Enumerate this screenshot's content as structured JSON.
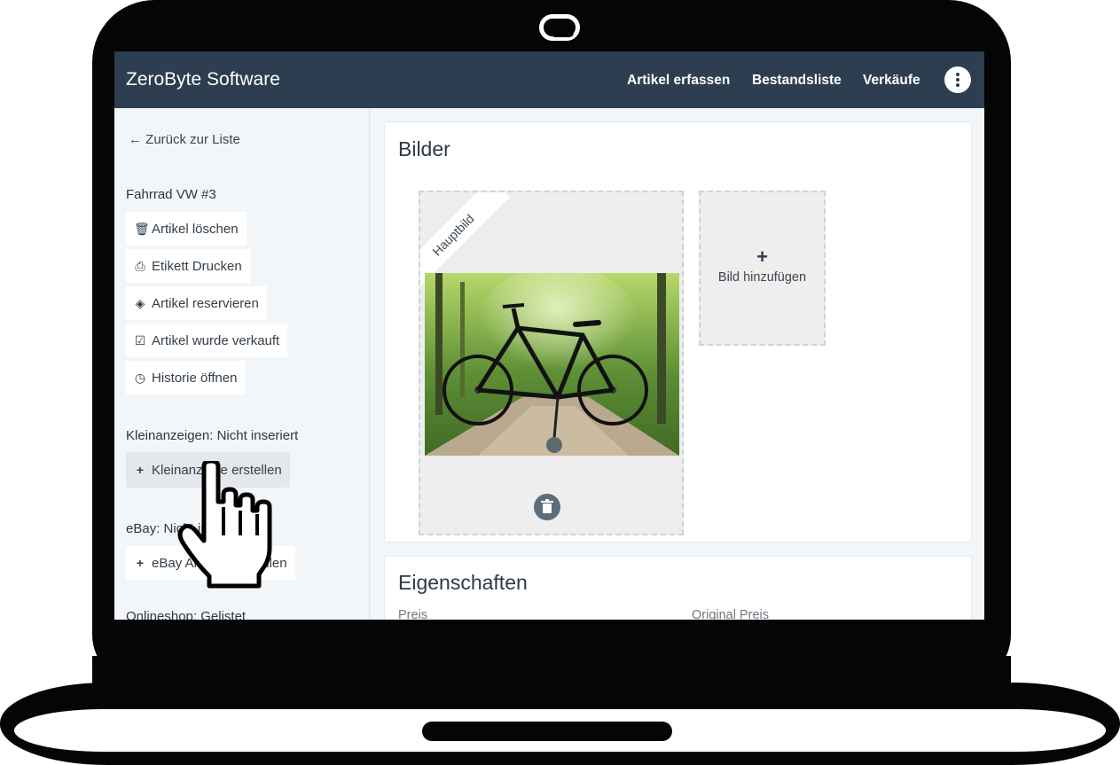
{
  "app": {
    "brand": "ZeroByte Software",
    "nav": [
      "Artikel erfassen",
      "Bestandsliste",
      "Verkäufe"
    ]
  },
  "sidebar": {
    "back_label": "Zurück zur Liste",
    "item_title": "Fahrrad VW #3",
    "actions": [
      {
        "label": "Artikel löschen",
        "icon": "trash-icon"
      },
      {
        "label": "Etikett Drucken",
        "icon": "printer-icon"
      },
      {
        "label": "Artikel reservieren",
        "icon": "tag-icon"
      },
      {
        "label": "Artikel wurde verkauft",
        "icon": "checkbox-icon"
      },
      {
        "label": "Historie öffnen",
        "icon": "clock-icon"
      }
    ],
    "kleinanzeigen": {
      "status": "Kleinanzeigen: Nicht inseriert",
      "create_label": "Kleinanzeige erstellen"
    },
    "ebay": {
      "status": "eBay: Nicht inseriert",
      "create_label": "eBay Anzeige erstellen"
    },
    "onlineshop": {
      "status": "Onlineshop: Gelistet"
    }
  },
  "bilder": {
    "title": "Bilder",
    "main_badge": "Hauptbild",
    "add_label": "Bild hinzufügen"
  },
  "eigenschaften": {
    "title": "Eigenschaften",
    "fields": [
      "Preis",
      "Original Preis"
    ]
  },
  "colors": {
    "topbar": "#2c3e50",
    "background": "#f3f6f9"
  }
}
